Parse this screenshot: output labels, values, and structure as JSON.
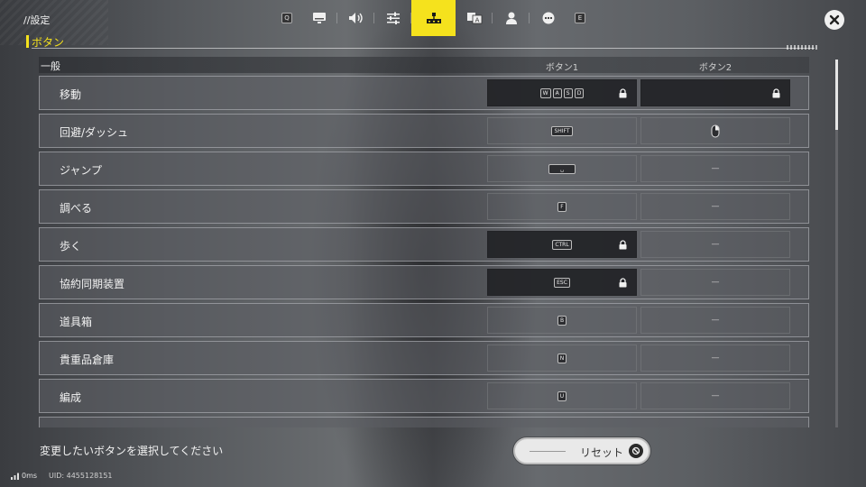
{
  "app": {
    "title": "//設定"
  },
  "topnav": {
    "items": [
      {
        "name": "key-q-hint",
        "key": "Q"
      },
      {
        "name": "display-icon"
      },
      {
        "name": "sound-icon"
      },
      {
        "name": "sliders-icon"
      },
      {
        "name": "controls-icon",
        "active": true
      },
      {
        "name": "language-icon"
      },
      {
        "name": "account-icon"
      },
      {
        "name": "more-icon"
      },
      {
        "name": "key-e-hint",
        "key": "E"
      }
    ],
    "accent": "#f5e21d"
  },
  "section": {
    "title": "ボタン"
  },
  "table": {
    "category": "一般",
    "col1": "ボタン1",
    "col2": "ボタン2",
    "rows": [
      {
        "label": "移動",
        "b1": [
          "W",
          "A",
          "S",
          "D"
        ],
        "b1_locked": true,
        "b2": "",
        "b2_locked": true
      },
      {
        "label": "回避/ダッシュ",
        "b1": [
          "SHIFT"
        ],
        "b2_icon": "mouse-right-icon"
      },
      {
        "label": "ジャンプ",
        "b1": [
          "␣"
        ],
        "b2": "—"
      },
      {
        "label": "調べる",
        "b1": [
          "F"
        ],
        "b2": "—"
      },
      {
        "label": "歩く",
        "b1": [
          "CTRL"
        ],
        "b1_locked": true,
        "b2": "—"
      },
      {
        "label": "協約同期装置",
        "b1": [
          "ESC"
        ],
        "b1_locked": true,
        "b2": "—"
      },
      {
        "label": "道具箱",
        "b1": [
          "B"
        ],
        "b2": "—"
      },
      {
        "label": "貴重品倉庫",
        "b1": [
          "N"
        ],
        "b2": "—"
      },
      {
        "label": "編成",
        "b1": [
          "U"
        ],
        "b2": "—"
      }
    ]
  },
  "footer": {
    "hint": "変更したいボタンを選択してください",
    "reset_label": "リセット",
    "ping": "0ms",
    "uid": "UID: 4455128151"
  }
}
